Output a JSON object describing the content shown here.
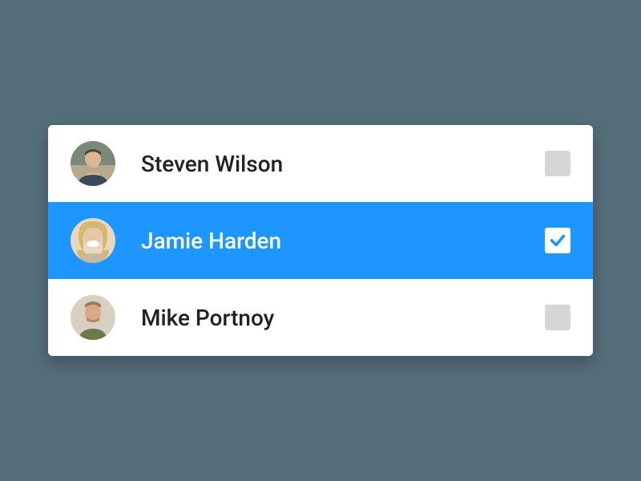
{
  "contacts": [
    {
      "name": "Steven Wilson",
      "selected": false
    },
    {
      "name": "Jamie Harden",
      "selected": true
    },
    {
      "name": "Mike Portnoy",
      "selected": false
    }
  ],
  "colors": {
    "background": "#546e7a",
    "selected": "#1e96ff",
    "checkbox_inactive": "#d6d6d6"
  }
}
